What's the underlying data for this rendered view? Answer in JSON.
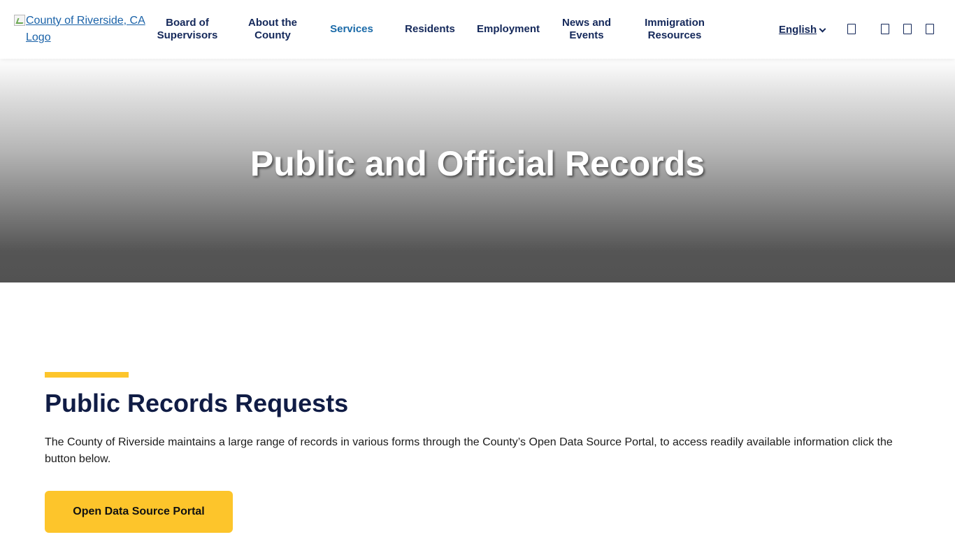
{
  "header": {
    "logo_alt": "County of Riverside, CA Logo",
    "nav": [
      {
        "label_line1": "Board of",
        "label_line2": "Supervisors"
      },
      {
        "label_line1": "About the",
        "label_line2": "County"
      },
      {
        "label": "Services"
      },
      {
        "label": "Residents"
      },
      {
        "label": "Employment"
      },
      {
        "label_line1": "News and",
        "label_line2": "Events"
      },
      {
        "label_line1": "Immigration",
        "label_line2": "Resources"
      }
    ],
    "language": "English",
    "colors": {
      "nav_text": "#14285a",
      "active_nav": "#1a6aa8",
      "logo_link": "#1a62a8"
    },
    "icons": [
      "search-icon",
      "social-icon",
      "social-icon",
      "social-icon"
    ]
  },
  "hero": {
    "title": "Public and Official Records"
  },
  "main": {
    "section_title": "Public Records Requests",
    "section_text": "The County of Riverside maintains a large range of records in various forms through the County’s Open Data Source Portal, to access readily available information click the button below.",
    "button_label": "Open Data Source Portal",
    "colors": {
      "accent": "#fdc52b",
      "title": "#101c45"
    }
  }
}
